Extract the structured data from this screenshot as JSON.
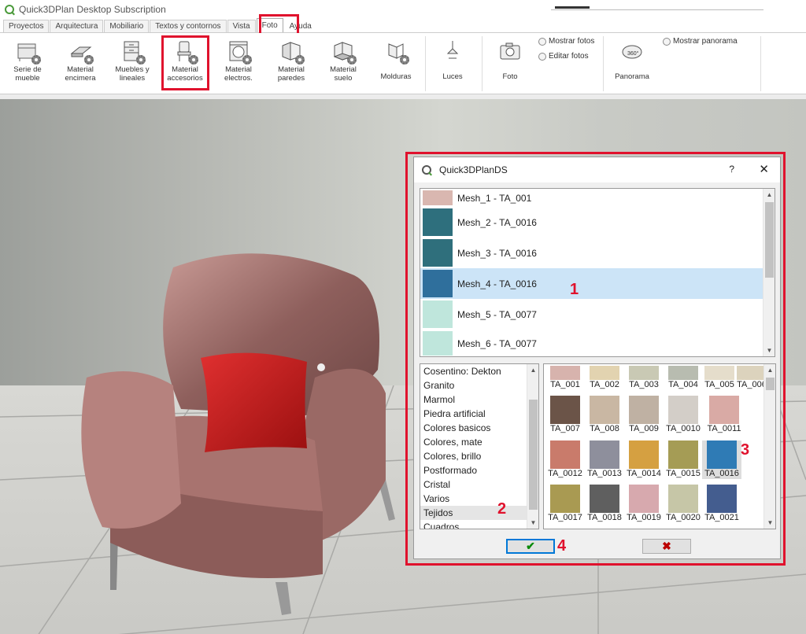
{
  "window": {
    "title": "Quick3DPlan Desktop Subscription"
  },
  "tabs": [
    "Proyectos",
    "Arquitectura",
    "Mobiliario",
    "Textos y contornos",
    "Vista",
    "Foto",
    "Ayuda"
  ],
  "active_tab": "Foto",
  "ribbon": {
    "buttons": [
      {
        "label": "Serie de\nmueble"
      },
      {
        "label": "Material\nencimera"
      },
      {
        "label": "Muebles y\nlineales"
      },
      {
        "label": "Material\naccesorios"
      },
      {
        "label": "Material\nelectros."
      },
      {
        "label": "Material\nparedes"
      },
      {
        "label": "Material\nsuelo"
      },
      {
        "label": "Molduras"
      },
      {
        "label": "Luces"
      },
      {
        "label": "Foto"
      },
      {
        "label": "Panorama"
      }
    ],
    "options": {
      "show_photos": "Mostrar fotos",
      "edit_photos": "Editar fotos",
      "show_panorama": "Mostrar panorama"
    }
  },
  "dialog": {
    "title": "Quick3DPlanDS",
    "help": "?",
    "close": "✕",
    "meshes": [
      {
        "name": "Mesh_1 - TA_001",
        "color": "#d9b7b0"
      },
      {
        "name": "Mesh_2 - TA_0016",
        "color": "#2e6f7d"
      },
      {
        "name": "Mesh_3 - TA_0016",
        "color": "#2f6f7c"
      },
      {
        "name": "Mesh_4 - TA_0016",
        "color": "#2f6f9c"
      },
      {
        "name": "Mesh_5 - TA_0077",
        "color": "#bfe6dc"
      },
      {
        "name": "Mesh_6 - TA_0077",
        "color": "#bfe6dc"
      }
    ],
    "selected_mesh": 3,
    "categories": [
      "Cosentino: Dekton",
      "Granito",
      "Marmol",
      "Piedra artificial",
      "Colores basicos",
      "Colores, mate",
      "Colores, brillo",
      "Postformado",
      "Cristal",
      "Varios",
      "Tejidos",
      "Cuadros"
    ],
    "selected_category": "Tejidos",
    "textures": [
      {
        "name": "TA_001",
        "color": "#d7b3ad"
      },
      {
        "name": "TA_002",
        "color": "#e2d3b0"
      },
      {
        "name": "TA_003",
        "color": "#c9c9b4"
      },
      {
        "name": "TA_004",
        "color": "#b8bcb0"
      },
      {
        "name": "TA_005",
        "color": "#e5ddcb"
      },
      {
        "name": "TA_006",
        "color": "#dcd3bd"
      },
      {
        "name": "TA_007",
        "color": "#6b5448"
      },
      {
        "name": "TA_008",
        "color": "#c9b7a3"
      },
      {
        "name": "TA_009",
        "color": "#bfb1a3"
      },
      {
        "name": "TA_0010",
        "color": "#d3cec8"
      },
      {
        "name": "TA_0011",
        "color": "#d9aaa5"
      },
      {
        "name": "TA_0012",
        "color": "#c97b6b"
      },
      {
        "name": "TA_0013",
        "color": "#8e8f9c"
      },
      {
        "name": "TA_0014",
        "color": "#d5a041"
      },
      {
        "name": "TA_0015",
        "color": "#a59c55"
      },
      {
        "name": "TA_0016",
        "color": "#2f7bb5"
      },
      {
        "name": "TA_0017",
        "color": "#a99a52"
      },
      {
        "name": "TA_0018",
        "color": "#5f5f5f"
      },
      {
        "name": "TA_0019",
        "color": "#d7a9ae"
      },
      {
        "name": "TA_0020",
        "color": "#c6c6a7"
      },
      {
        "name": "TA_0021",
        "color": "#445d8f"
      }
    ],
    "selected_texture": "TA_0016",
    "ok": "✔",
    "cancel": "✖"
  },
  "annotations": [
    "1",
    "2",
    "3",
    "4"
  ],
  "colors": {
    "highlight": "#e0122d",
    "selection": "#cce4f7",
    "ok_check": "#0a8a0a",
    "cancel_x": "#b00000"
  }
}
